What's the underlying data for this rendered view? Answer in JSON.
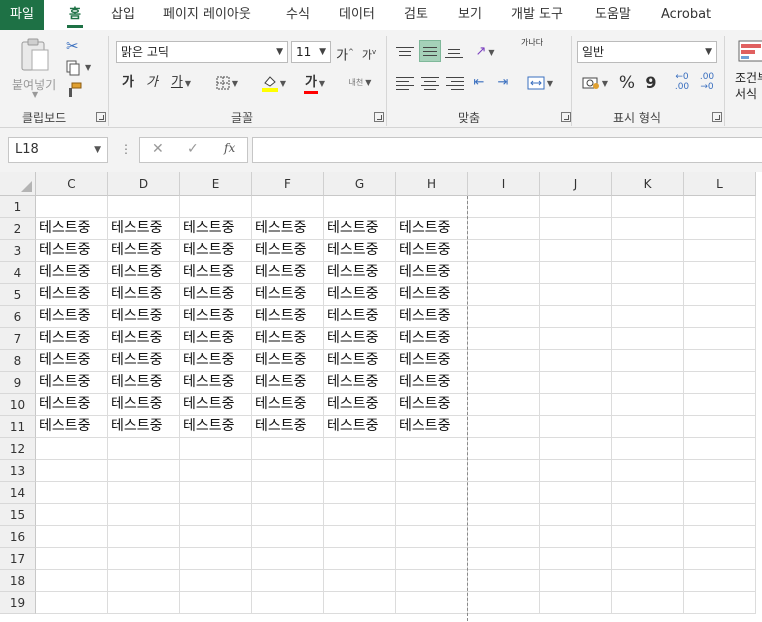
{
  "tabs": [
    "파일",
    "홈",
    "삽입",
    "페이지 레이아웃",
    "수식",
    "데이터",
    "검토",
    "보기",
    "개발 도구",
    "도움말",
    "Acrobat"
  ],
  "ribbon": {
    "clipboard": {
      "paste_label": "붙여넣기",
      "group_label": "클립보드"
    },
    "font": {
      "font_name": "맑은 고딕",
      "font_size": "11",
      "grow_label": "가",
      "shrink_label": "가",
      "bold_label": "가",
      "italic_label": "가",
      "underline_label": "가",
      "fontcolor_label": "가",
      "phonetic_label": "내천",
      "group_label": "글꼴"
    },
    "alignment": {
      "wrap_label": "가나다",
      "group_label": "맞춤"
    },
    "number": {
      "format": "일반",
      "percent_label": "%",
      "comma_label": "9",
      "inc_decimal_label": ".00",
      "dec_decimal_label": ".00",
      "group_label": "표시 형식"
    },
    "styles": {
      "cond_label_1": "조건부",
      "cond_label_2": "서식"
    },
    "colors": {
      "accent": "#1e7145",
      "font_color_bar": "#ff0000",
      "fill_color_bar": "#ffff00"
    }
  },
  "formula_bar": {
    "name_box": "L18",
    "cancel_icon": "✕",
    "enter_icon": "✓",
    "fx_label": "fx",
    "formula": ""
  },
  "grid": {
    "columns": [
      "C",
      "D",
      "E",
      "F",
      "G",
      "H",
      "I",
      "J",
      "K",
      "L"
    ],
    "rows": [
      "1",
      "2",
      "3",
      "4",
      "5",
      "6",
      "7",
      "8",
      "9",
      "10",
      "11",
      "12",
      "13",
      "14",
      "15",
      "16",
      "17",
      "18",
      "19"
    ],
    "cell_text": "테스트중",
    "filled_rows": [
      2,
      11
    ],
    "filled_cols": [
      "C",
      "H"
    ]
  }
}
